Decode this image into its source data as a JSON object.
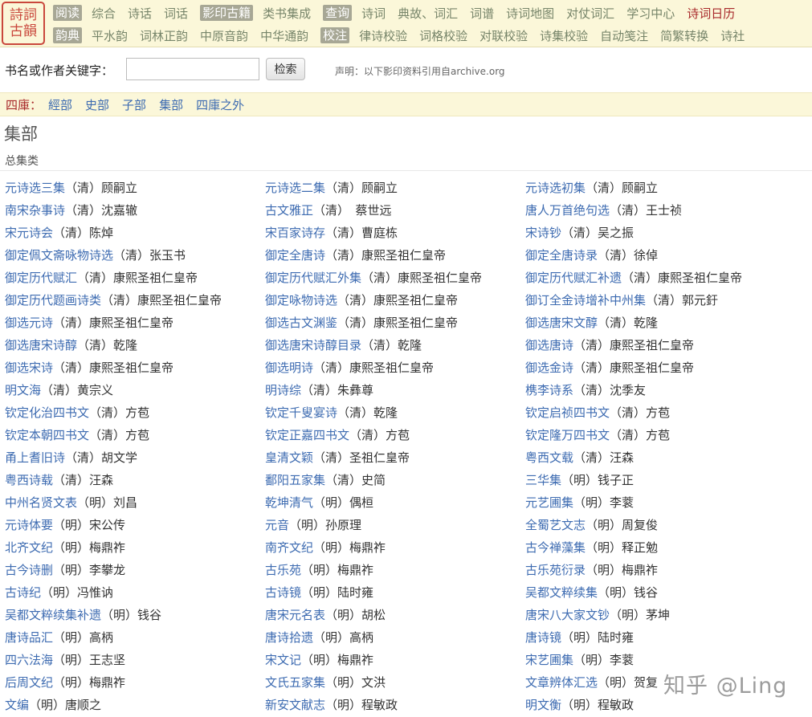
{
  "logo": {
    "line1": "詩詞",
    "line2": "古韻"
  },
  "nav": {
    "row1": [
      {
        "label": "阅读",
        "tag": true
      },
      {
        "label": "综合"
      },
      {
        "label": "诗话"
      },
      {
        "label": "词话"
      },
      {
        "label": "影印古籍",
        "tag": true
      },
      {
        "label": "类书集成"
      },
      {
        "label": "查询",
        "tag": true
      },
      {
        "label": "诗词"
      },
      {
        "label": "典故、词汇"
      },
      {
        "label": "词谱"
      },
      {
        "label": "诗词地图"
      },
      {
        "label": "对仗词汇"
      },
      {
        "label": "学习中心"
      },
      {
        "label": "诗词日历",
        "active": true
      }
    ],
    "row2": [
      {
        "label": "韵典",
        "tag": true
      },
      {
        "label": "平水韵"
      },
      {
        "label": "词林正韵"
      },
      {
        "label": "中原音韵"
      },
      {
        "label": "中华通韵"
      },
      {
        "label": "校注",
        "tag": true
      },
      {
        "label": "律诗校验"
      },
      {
        "label": "词格校验"
      },
      {
        "label": "对联校验"
      },
      {
        "label": "诗集校验"
      },
      {
        "label": "自动笺注"
      },
      {
        "label": "简繁转换"
      },
      {
        "label": "诗社"
      }
    ]
  },
  "search": {
    "label": "书名或作者关键字：",
    "value": "",
    "placeholder": "",
    "button_label": "检索",
    "disclaimer": "声明：以下影印资料引用自archive.org"
  },
  "siku": {
    "label": "四庫：",
    "links": [
      "經部",
      "史部",
      "子部",
      "集部",
      "四庫之外"
    ]
  },
  "section": {
    "title": "集部",
    "subcategory": "总集类"
  },
  "books": [
    {
      "title": "元诗选三集",
      "author": "（清）顾嗣立"
    },
    {
      "title": "元诗选二集",
      "author": "（清）顾嗣立"
    },
    {
      "title": "元诗选初集",
      "author": "（清）顾嗣立"
    },
    {
      "title": "南宋杂事诗",
      "author": "（清）沈嘉辙"
    },
    {
      "title": "古文雅正",
      "author": "（清）　蔡世远"
    },
    {
      "title": "唐人万首绝句选",
      "author": "（清）王士祯"
    },
    {
      "title": "宋元诗会",
      "author": "（清）陈焯"
    },
    {
      "title": "宋百家诗存",
      "author": "（清）曹庭栋"
    },
    {
      "title": "宋诗钞",
      "author": "（清）吴之振"
    },
    {
      "title": "御定佩文斋咏物诗选",
      "author": "（清）张玉书"
    },
    {
      "title": "御定全唐诗",
      "author": "（清）康熙圣祖仁皇帝"
    },
    {
      "title": "御定全唐诗录",
      "author": "（清）徐倬"
    },
    {
      "title": "御定历代赋汇",
      "author": "（清）康熙圣祖仁皇帝"
    },
    {
      "title": "御定历代赋汇外集",
      "author": "（清）康熙圣祖仁皇帝"
    },
    {
      "title": "御定历代赋汇补遗",
      "author": "（清）康熙圣祖仁皇帝"
    },
    {
      "title": "御定历代题画诗类",
      "author": "（清）康熙圣祖仁皇帝"
    },
    {
      "title": "御定咏物诗选",
      "author": "（清）康熙圣祖仁皇帝"
    },
    {
      "title": "御订全金诗增补中州集",
      "author": "（清）郭元釪"
    },
    {
      "title": "御选元诗",
      "author": "（清）康熙圣祖仁皇帝"
    },
    {
      "title": "御选古文渊鉴",
      "author": "（清）康熙圣祖仁皇帝"
    },
    {
      "title": "御选唐宋文醇",
      "author": "（清）乾隆"
    },
    {
      "title": "御选唐宋诗醇",
      "author": "（清）乾隆"
    },
    {
      "title": "御选唐宋诗醇目录",
      "author": "（清）乾隆"
    },
    {
      "title": "御选唐诗",
      "author": "（清）康熙圣祖仁皇帝"
    },
    {
      "title": "御选宋诗",
      "author": "（清）康熙圣祖仁皇帝"
    },
    {
      "title": "御选明诗",
      "author": "（清）康熙圣祖仁皇帝"
    },
    {
      "title": "御选金诗",
      "author": "（清）康熙圣祖仁皇帝"
    },
    {
      "title": "明文海",
      "author": "（清）黄宗义"
    },
    {
      "title": "明诗综",
      "author": "（清）朱彝尊"
    },
    {
      "title": "槜李诗系",
      "author": "（清）沈季友"
    },
    {
      "title": "钦定化治四书文",
      "author": "（清）方苞"
    },
    {
      "title": "钦定千叟宴诗",
      "author": "（清）乾隆"
    },
    {
      "title": "钦定启祯四书文",
      "author": "（清）方苞"
    },
    {
      "title": "钦定本朝四书文",
      "author": "（清）方苞"
    },
    {
      "title": "钦定正嘉四书文",
      "author": "（清）方苞"
    },
    {
      "title": "钦定隆万四书文",
      "author": "（清）方苞"
    },
    {
      "title": "甬上耆旧诗",
      "author": "（清）胡文学"
    },
    {
      "title": "皇清文颖",
      "author": "（清）圣祖仁皇帝"
    },
    {
      "title": "粤西文载",
      "author": "（清）汪森"
    },
    {
      "title": "粤西诗载",
      "author": "（清）汪森"
    },
    {
      "title": "鄱阳五家集",
      "author": "（清）史简"
    },
    {
      "title": "三华集",
      "author": "（明）钱子正"
    },
    {
      "title": "中州名贤文表",
      "author": "（明）刘昌"
    },
    {
      "title": "乾坤清气",
      "author": "（明）偶桓"
    },
    {
      "title": "元艺圃集",
      "author": "（明）李蓘"
    },
    {
      "title": "元诗体要",
      "author": "（明）宋公传"
    },
    {
      "title": "元音",
      "author": "（明）孙原理"
    },
    {
      "title": "全蜀艺文志",
      "author": "（明）周复俊"
    },
    {
      "title": "北齐文纪",
      "author": "（明）梅鼎祚"
    },
    {
      "title": "南齐文纪",
      "author": "（明）梅鼎祚"
    },
    {
      "title": "古今禅藻集",
      "author": "（明）释正勉"
    },
    {
      "title": "古今诗删",
      "author": "（明）李攀龙"
    },
    {
      "title": "古乐苑",
      "author": "（明）梅鼎祚"
    },
    {
      "title": "古乐苑衍录",
      "author": "（明）梅鼎祚"
    },
    {
      "title": "古诗纪",
      "author": "（明）冯惟讷"
    },
    {
      "title": "古诗镜",
      "author": "（明）陆时雍"
    },
    {
      "title": "吴都文粹续集",
      "author": "（明）钱谷"
    },
    {
      "title": "吴都文粹续集补遗",
      "author": "（明）钱谷"
    },
    {
      "title": "唐宋元名表",
      "author": "（明）胡松"
    },
    {
      "title": "唐宋八大家文钞",
      "author": "（明）茅坤"
    },
    {
      "title": "唐诗品汇",
      "author": "（明）高柄"
    },
    {
      "title": "唐诗拾遗",
      "author": "（明）高柄"
    },
    {
      "title": "唐诗镜",
      "author": "（明）陆时雍"
    },
    {
      "title": "四六法海",
      "author": "（明）王志坚"
    },
    {
      "title": "宋文记",
      "author": "（明）梅鼎祚"
    },
    {
      "title": "宋艺圃集",
      "author": "（明）李蓘"
    },
    {
      "title": "后周文纪",
      "author": "（明）梅鼎祚"
    },
    {
      "title": "文氏五家集",
      "author": "（明）文洪"
    },
    {
      "title": "文章辨体汇选",
      "author": "（明）贺复"
    },
    {
      "title": "文编",
      "author": "（明）唐顺之"
    },
    {
      "title": "新安文献志",
      "author": "（明）程敏政"
    },
    {
      "title": "明文衡",
      "author": "（明）程敏政"
    }
  ],
  "watermark": "知乎 @Ling",
  "colors": {
    "nav_background": "#fbf7d9",
    "nav_tag_background": "#a7a795",
    "nav_link": "#77856a",
    "active_red": "#a8282a",
    "link_blue": "#3d6bb1"
  }
}
